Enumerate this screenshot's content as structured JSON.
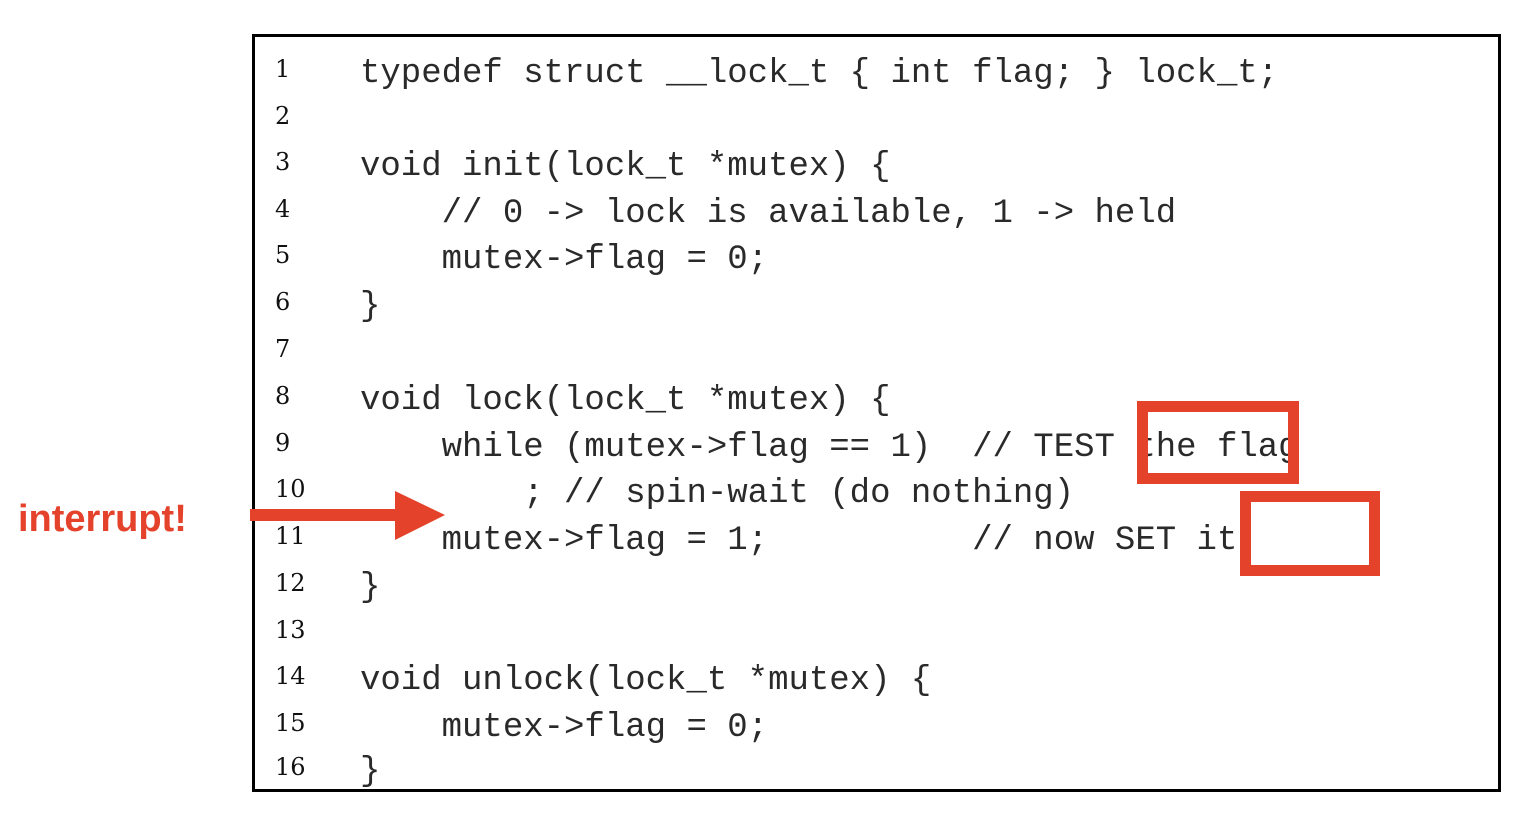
{
  "annotation": {
    "label": "interrupt!",
    "color": "#e4422b"
  },
  "code_lines": [
    {
      "num": "1",
      "text": "typedef struct __lock_t { int flag; } lock_t;"
    },
    {
      "num": "2",
      "text": ""
    },
    {
      "num": "3",
      "text": "void init(lock_t *mutex) {"
    },
    {
      "num": "4",
      "text": "    // 0 -> lock is available, 1 -> held"
    },
    {
      "num": "5",
      "text": "    mutex->flag = 0;"
    },
    {
      "num": "6",
      "text": "}"
    },
    {
      "num": "7",
      "text": ""
    },
    {
      "num": "8",
      "text": "void lock(lock_t *mutex) {"
    },
    {
      "num": "9",
      "text": "    while (mutex->flag == 1)  // TEST the flag"
    },
    {
      "num": "10",
      "text": "        ; // spin-wait (do nothing)"
    },
    {
      "num": "11",
      "text": "    mutex->flag = 1;          // now SET it!"
    },
    {
      "num": "12",
      "text": "}"
    },
    {
      "num": "13",
      "text": ""
    },
    {
      "num": "14",
      "text": "void unlock(lock_t *mutex) {"
    },
    {
      "num": "15",
      "text": "    mutex->flag = 0;"
    },
    {
      "num": "16",
      "text": "}"
    }
  ],
  "highlights": [
    {
      "name": "test-highlight-box",
      "word": "TEST"
    },
    {
      "name": "set-highlight-box",
      "word": "SET"
    }
  ]
}
